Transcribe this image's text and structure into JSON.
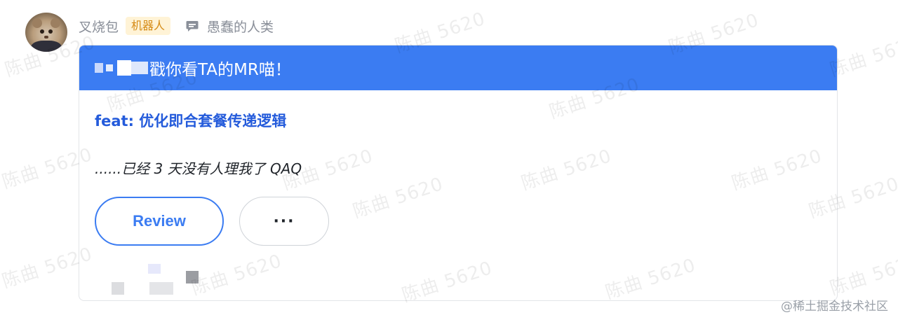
{
  "sender": {
    "name": "叉烧包",
    "badge": "机器人"
  },
  "reply": {
    "icon": "chat-bubble-icon",
    "text": "愚蠢的人类"
  },
  "card": {
    "header_title": "戳你看TA的MR喵！",
    "header_color": "#3b7cf2",
    "mr_title": "feat: 优化即合套餐传递逻辑",
    "mr_title_color": "#245bdb",
    "description": "......已经 3 天没有人理我了 QAQ",
    "review_button": "Review",
    "more_button": "···"
  },
  "watermark": {
    "text": "陈曲 5620",
    "site": "@稀土掘金技术社区"
  }
}
